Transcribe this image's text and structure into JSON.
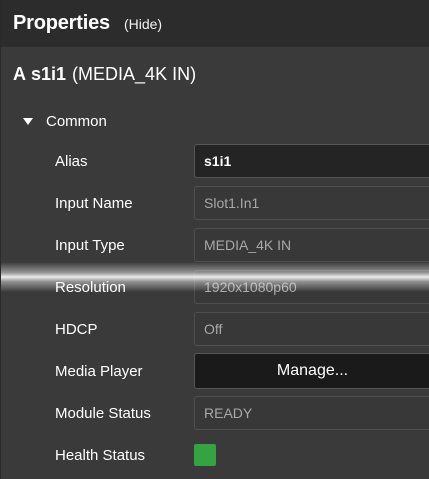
{
  "header": {
    "title": "Properties",
    "hide_label": "(Hide)"
  },
  "device": {
    "prefix": "A",
    "name": "s1i1",
    "type": "(MEDIA_4K IN)"
  },
  "section": {
    "label": "Common"
  },
  "properties": {
    "alias": {
      "label": "Alias",
      "value": "s1i1"
    },
    "input_name": {
      "label": "Input Name",
      "value": "Slot1.In1"
    },
    "input_type": {
      "label": "Input Type",
      "value": "MEDIA_4K IN"
    },
    "resolution": {
      "label": "Resolution",
      "value": "1920x1080p60"
    },
    "hdcp": {
      "label": "HDCP",
      "value": "Off"
    },
    "media_player": {
      "label": "Media Player",
      "button_label": "Manage..."
    },
    "module_status": {
      "label": "Module Status",
      "value": "READY"
    },
    "health_status": {
      "label": "Health Status",
      "status_color": "#35a341"
    }
  }
}
